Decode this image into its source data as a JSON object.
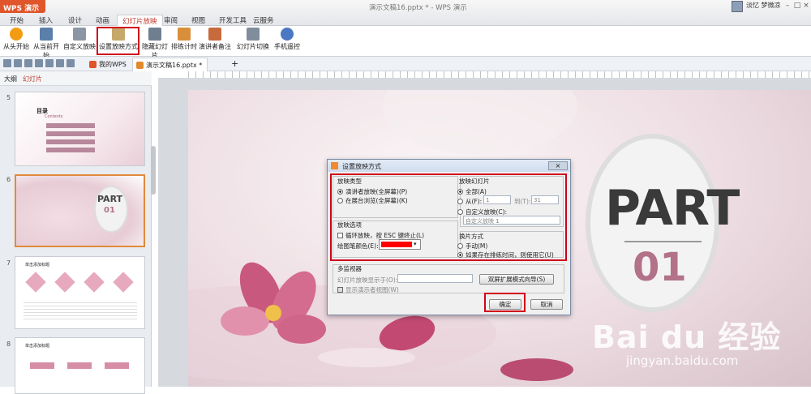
{
  "app": {
    "name": "WPS 演示",
    "doc_title": "演示文稿16.pptx * - WPS 演示"
  },
  "menu_tabs": [
    "开始",
    "插入",
    "设计",
    "动画",
    "幻灯片放映",
    "审阅",
    "视图",
    "开发工具",
    "云服务"
  ],
  "user": {
    "name": "淡忆 梦微凉"
  },
  "ribbon": [
    "从头开始",
    "从当前开始",
    "自定义放映",
    "设置放映方式",
    "隐藏幻灯片",
    "排练计时",
    "演讲者备注",
    "幻灯片切换",
    "手机遥控"
  ],
  "tabs": {
    "mywps": "我的WPS",
    "doc": "演示文稿16.pptx *",
    "add": "+"
  },
  "pane": {
    "outline": "大纲",
    "slides": "幻灯片"
  },
  "thumbs": [
    {
      "num": "5",
      "title": "目录",
      "subtitle": "Contents"
    },
    {
      "num": "6",
      "title": "PART",
      "subtitle": "01"
    },
    {
      "num": "7",
      "title": "单击添加标题"
    },
    {
      "num": "8",
      "title": "单击添加标题"
    }
  ],
  "slide": {
    "part": "PART",
    "num": "01"
  },
  "dialog": {
    "title": "设置放映方式",
    "type_group": "放映类型",
    "type_opt1": "演讲者放映(全屏幕)(P)",
    "type_opt2": "在展台浏览(全屏幕)(K)",
    "opts_group": "放映选项",
    "loop": "循环放映，按 ESC 键终止(L)",
    "pen_color": "绘图笔颜色(E):",
    "slides_group": "放映幻灯片",
    "all": "全部(A)",
    "from": "从(F):",
    "from_val": "1",
    "to": "到(T):",
    "to_val": "31",
    "custom": "自定义放映(C):",
    "custom_val": "自定义放映 1",
    "advance_group": "换片方式",
    "manual": "手动(M)",
    "timing": "如果存在排练时间，则使用它(U)",
    "monitor_group": "多监视器",
    "show_on": "幻灯片放映显示于(O):",
    "presenter_view": "显示演示者视图(W)",
    "dual_screen": "双屏扩展模式向导(S)",
    "ok": "确定",
    "cancel": "取消"
  },
  "watermark": {
    "logo": "Bai du 经验",
    "url": "jingyan.baidu.com"
  },
  "colors": {
    "accent": "#d0021b",
    "pen": "#ff0000",
    "wps": "#e0552a"
  }
}
